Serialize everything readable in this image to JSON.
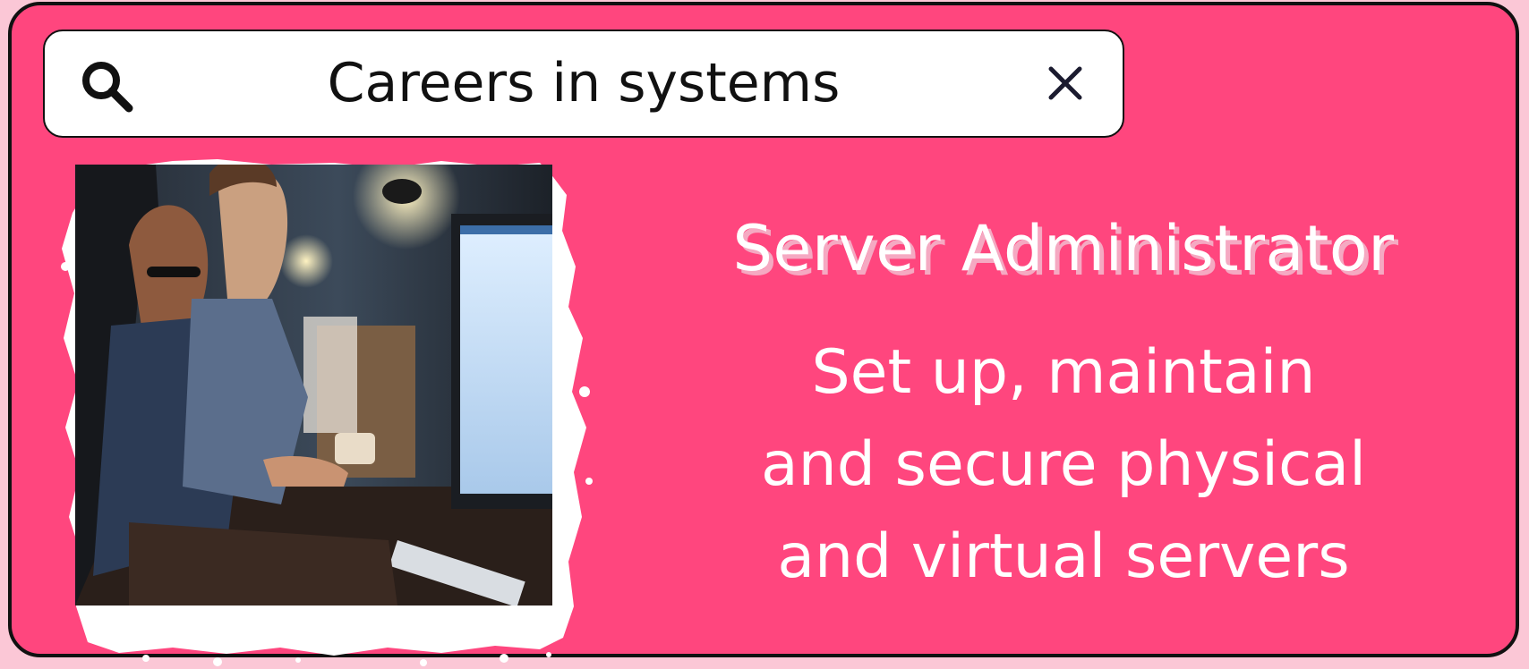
{
  "search": {
    "query": "Careers in systems",
    "icon": "search-icon",
    "clear_icon": "close-icon"
  },
  "card": {
    "background": "#ff467e",
    "image_alt": "Three people looking at a computer monitor in an office",
    "title": "Server Administrator",
    "description_lines": [
      "Set up, maintain",
      "and secure physical",
      "and virtual servers"
    ]
  },
  "colors": {
    "page_background": "#fbc7d6",
    "card": "#ff467e",
    "title_shadow": "#f5a9c2",
    "text": "#ffffff"
  }
}
